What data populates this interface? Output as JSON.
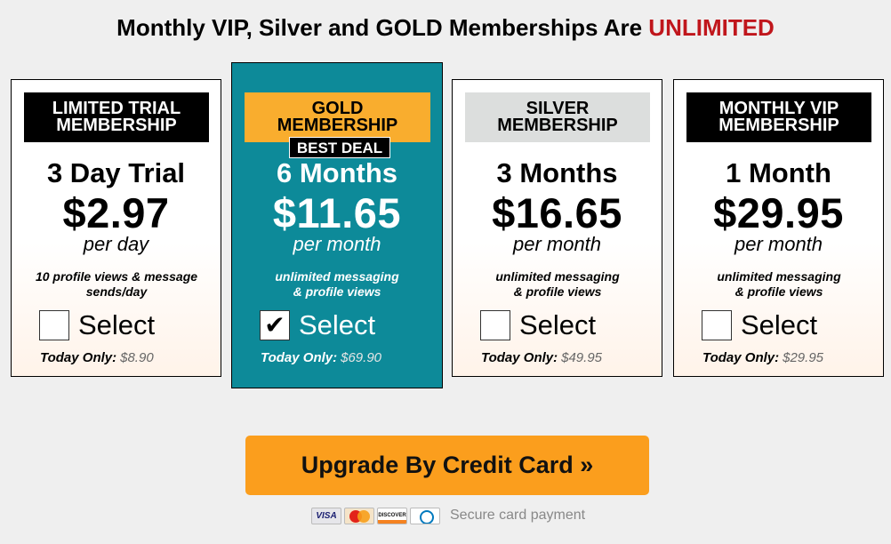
{
  "heading": {
    "text": "Monthly VIP, Silver and GOLD Memberships Are ",
    "highlight": "UNLIMITED",
    "highlight_color": "#c0161c"
  },
  "plans": [
    {
      "header_line1": "LIMITED TRIAL",
      "header_line2": "MEMBERSHIP",
      "duration": "3 Day Trial",
      "price": "$2.97",
      "unit": "per day",
      "desc_line1": "10 profile views & message",
      "desc_line2": "sends/day",
      "checked": false,
      "select_label": "Select",
      "today_label": "Today Only:",
      "today_price": "$8.90"
    },
    {
      "header_line1": "GOLD",
      "header_line2": "MEMBERSHIP",
      "badge": "BEST DEAL",
      "duration": "6 Months",
      "price": "$11.65",
      "unit": "per month",
      "desc_line1": "unlimited messaging",
      "desc_line2": "& profile views",
      "checked": true,
      "check_mark": "✔",
      "select_label": "Select",
      "today_label": "Today Only:",
      "today_price": "$69.90"
    },
    {
      "header_line1": "SILVER",
      "header_line2": "MEMBERSHIP",
      "duration": "3 Months",
      "price": "$16.65",
      "unit": "per month",
      "desc_line1": "unlimited messaging",
      "desc_line2": "& profile views",
      "checked": false,
      "select_label": "Select",
      "today_label": "Today Only:",
      "today_price": "$49.95"
    },
    {
      "header_line1": "MONTHLY VIP",
      "header_line2": "MEMBERSHIP",
      "duration": "1 Month",
      "price": "$29.95",
      "unit": "per month",
      "desc_line1": "unlimited messaging",
      "desc_line2": "& profile views",
      "checked": false,
      "select_label": "Select",
      "today_label": "Today Only:",
      "today_price": "$29.95"
    }
  ],
  "colors": {
    "featured_bg": "#0d8a99",
    "gold": "#f9ad2e",
    "silver": "#dcdedd",
    "cta": "#fb9e1d"
  },
  "cta": {
    "label": "Upgrade By Credit Card »"
  },
  "payment": {
    "cards": [
      "VISA",
      "MasterCard",
      "DISCOVER",
      "Diners Club"
    ],
    "secure_text": "Secure card payment"
  }
}
